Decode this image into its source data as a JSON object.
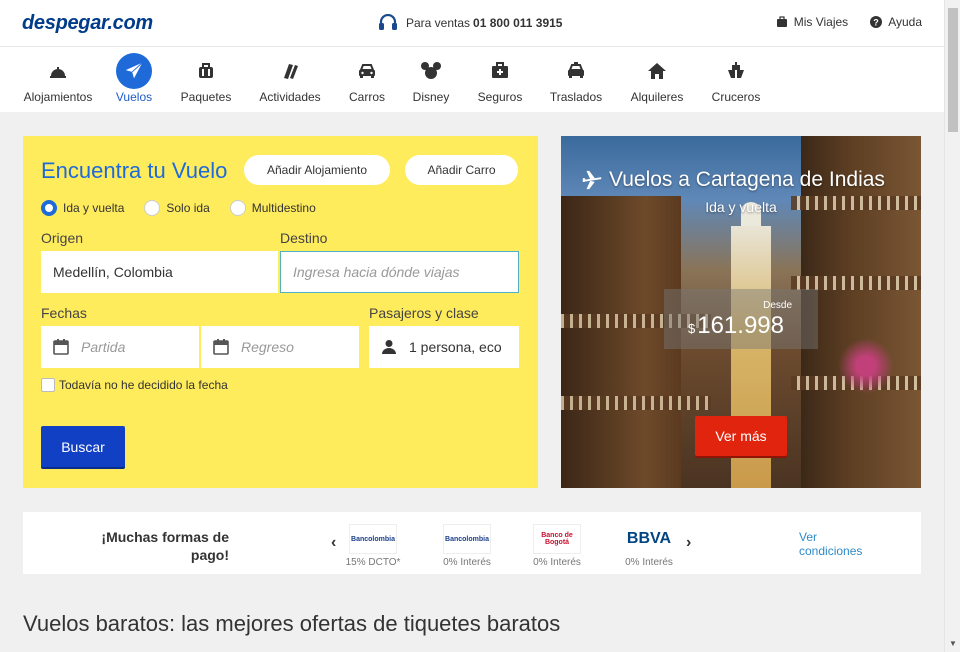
{
  "header": {
    "logo": "despegar.com",
    "phone_label": "Para ventas",
    "phone_number": "01 800 011 3915",
    "links": [
      {
        "label": "Mis Viajes",
        "icon": "suitcase-icon"
      },
      {
        "label": "Ayuda",
        "icon": "help-icon"
      }
    ]
  },
  "nav": {
    "items": [
      {
        "label": "Alojamientos",
        "icon": "bell-icon"
      },
      {
        "label": "Vuelos",
        "icon": "plane-icon",
        "active": true
      },
      {
        "label": "Paquetes",
        "icon": "luggage-icon"
      },
      {
        "label": "Actividades",
        "icon": "tickets-icon"
      },
      {
        "label": "Carros",
        "icon": "car-icon"
      },
      {
        "label": "Disney",
        "icon": "mickey-icon"
      },
      {
        "label": "Seguros",
        "icon": "first-aid-icon"
      },
      {
        "label": "Traslados",
        "icon": "taxi-icon"
      },
      {
        "label": "Alquileres",
        "icon": "house-icon"
      },
      {
        "label": "Cruceros",
        "icon": "ship-icon"
      }
    ]
  },
  "search": {
    "title": "Encuentra tu Vuelo",
    "add_lodging": "Añadir  Alojamiento",
    "add_car": "Añadir  Carro",
    "trip_types": [
      {
        "label": "Ida y vuelta",
        "selected": true
      },
      {
        "label": "Solo ida",
        "selected": false
      },
      {
        "label": "Multidestino",
        "selected": false
      }
    ],
    "origin_label": "Origen",
    "origin_value": "Medellín, Colombia",
    "destination_label": "Destino",
    "destination_placeholder": "Ingresa hacia dónde viajas",
    "dates_label": "Fechas",
    "departure_placeholder": "Partida",
    "return_placeholder": "Regreso",
    "passengers_label": "Pasajeros y clase",
    "passengers_value": "1 persona, eco",
    "undecided_label": "Todavía no he decidido la fecha",
    "submit_label": "Buscar",
    "accent": "#1e6ad9",
    "background": "#ffec5c"
  },
  "promo": {
    "title": "Vuelos a Cartagena de Indias",
    "subtitle": "Ida y vuelta",
    "from_label": "Desde",
    "currency": "$",
    "price": "161.998",
    "cta": "Ver más"
  },
  "payments": {
    "title": "¡Muchas formas de pago!",
    "prev": "‹",
    "next": "›",
    "cards": [
      {
        "logo": "Bancolombia",
        "caption": "15% DCTO*"
      },
      {
        "logo": "Bancolombia",
        "caption": "0% Interés"
      },
      {
        "logo": "Banco de Bogotá",
        "caption": "0% Interés"
      },
      {
        "logo": "BBVA",
        "caption": "0% Interés"
      }
    ],
    "conditions_link": "Ver condiciones"
  },
  "headline": "Vuelos baratos: las mejores ofertas de tiquetes baratos"
}
